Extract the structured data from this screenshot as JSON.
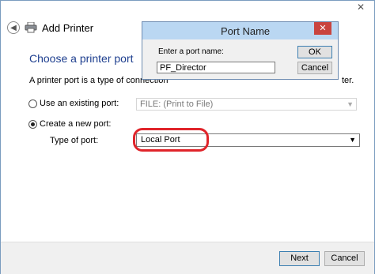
{
  "window": {
    "close_glyph": "✕"
  },
  "header": {
    "title": "Add Printer",
    "back_glyph": "◀"
  },
  "main": {
    "section_title": "Choose a printer port",
    "description": "A printer port is a type of connection",
    "description_tail": "ter.",
    "options": [
      {
        "label": "Use an existing port:",
        "checked": false,
        "value": "FILE: (Print to File)"
      },
      {
        "label": "Create a new port:",
        "checked": true
      }
    ],
    "type_of_port_label": "Type of port:",
    "type_of_port_value": "Local Port",
    "highlight_color": "#e0242a"
  },
  "footer": {
    "next_label": "Next",
    "cancel_label": "Cancel"
  },
  "dialog": {
    "title": "Port Name",
    "close_glyph": "✕",
    "prompt": "Enter a port name:",
    "input_value": "PF_Director",
    "ok_label": "OK",
    "cancel_label": "Cancel",
    "title_bar_color": "#bad7f2",
    "close_color": "#c9443e"
  },
  "icons": {
    "dropdown_arrow": "▼"
  }
}
